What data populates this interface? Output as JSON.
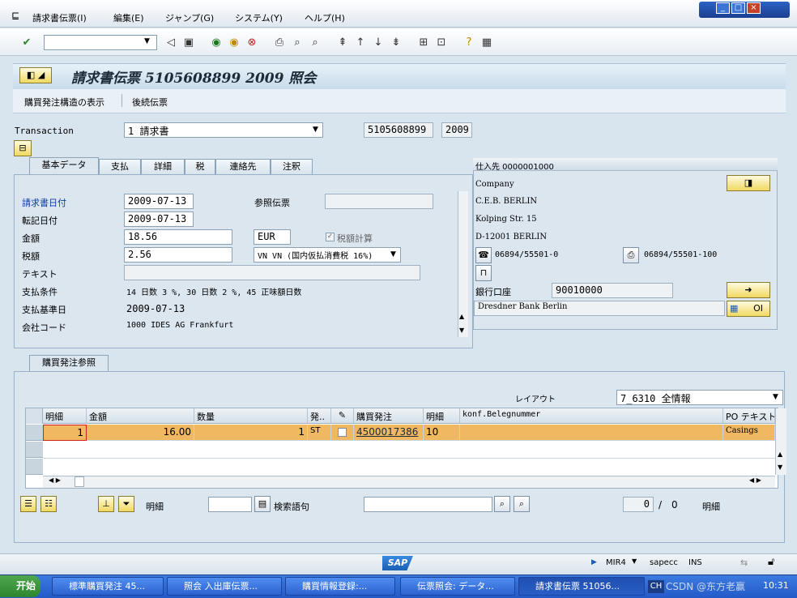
{
  "menu": [
    "請求書伝票(I)",
    "編集(E)",
    "ジャンプ(G)",
    "システム(Y)",
    "ヘルプ(H)"
  ],
  "window_controls": {
    "minimize": "_",
    "maximize": "□",
    "close": "×"
  },
  "title": "請求書伝票 5105608899 2009 照会",
  "app_toolbar": {
    "po_structure": "購買発注構造の表示",
    "followup": "後続伝票"
  },
  "header": {
    "transaction_label": "Transaction",
    "transaction_value": "1 請求書",
    "doc_number": "5105608899",
    "year": "2009"
  },
  "tabs": [
    "基本データ",
    "支払",
    "詳細",
    "税",
    "連絡先",
    "注釈"
  ],
  "basic": {
    "invoice_date_label": "請求書日付",
    "invoice_date": "2009-07-13",
    "reference_label": "参照伝票",
    "reference": "",
    "posting_date_label": "転記日付",
    "posting_date": "2009-07-13",
    "amount_label": "金額",
    "amount": "18.56",
    "currency": "EUR",
    "calc_tax_label": "税額計算",
    "tax_label": "税額",
    "tax": "2.56",
    "tax_code": "VN VN (国内仮払消費税 16%)",
    "text_label": "テキスト",
    "text": "",
    "payterms_label": "支払条件",
    "payterms": "14 日数 3 %, 30 日数 2 %, 45 正味額日数",
    "baseline_label": "支払基準日",
    "baseline": "2009-07-13",
    "company_label": "会社コード",
    "company": "1000 IDES AG Frankfurt"
  },
  "vendor": {
    "header": "仕入先 0000001000",
    "line1": "Company",
    "line2": "C.E.B. BERLIN",
    "line3": "Kolping Str. 15",
    "line4": "D-12001 BERLIN",
    "phone": "06894/55501-0",
    "fax": "06894/55501-100",
    "bank_label": "銀行口座",
    "bank_account": "90010000",
    "bank_name": "Dresdner Bank Berlin",
    "oi": "OI"
  },
  "po_section": {
    "tab": "購買発注参照",
    "layout_label": "レイアウト",
    "layout_value": "7_6310 全情報",
    "columns": [
      "明細",
      "金額",
      "数量",
      "発..",
      "",
      "購買発注",
      "明細",
      "konf.Belegnummer",
      "PO テキスト"
    ],
    "row": {
      "item": "1",
      "amount": "16.00",
      "qty": "1",
      "unit": "ST",
      "po": "4500017386",
      "po_item": "10",
      "conf": "",
      "text": "Casings"
    },
    "item_label": "明細",
    "search_label": "検索語句",
    "pager_current": "0",
    "pager_sep": "/",
    "pager_total": "0",
    "pager_label": "明細"
  },
  "status": {
    "tx": "MIR4",
    "system": "sapecc",
    "mode": "INS"
  },
  "taskbar": {
    "start": "开始",
    "tasks": [
      "標準購買発注 45...",
      "照会 入出庫伝票...",
      "購買情報登録:...",
      "伝票照会: データ...",
      "請求書伝票 51056..."
    ],
    "lang": "CH",
    "clock": "10:31",
    "watermark": "CSDN @东方老赢"
  },
  "colors": {
    "selected_row": "#f0b860",
    "sap_blue": "#1b5fb4"
  }
}
